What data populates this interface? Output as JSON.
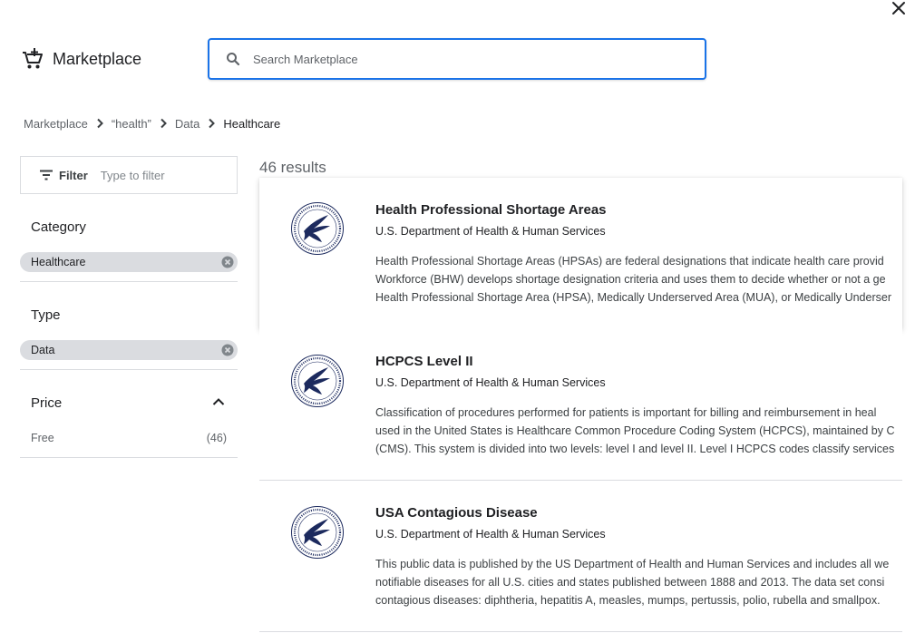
{
  "header": {
    "title": "Marketplace",
    "brand_icon": "cart-icon",
    "close_icon": "close-icon"
  },
  "search": {
    "placeholder": "Search Marketplace",
    "value": ""
  },
  "breadcrumb": [
    "Marketplace",
    "“health”",
    "Data",
    "Healthcare"
  ],
  "filter": {
    "label": "Filter",
    "placeholder": "Type to filter"
  },
  "facets": {
    "category": {
      "title": "Category",
      "chip": "Healthcare"
    },
    "type": {
      "title": "Type",
      "chip": "Data"
    },
    "price": {
      "title": "Price",
      "option": "Free",
      "count": "(46)"
    }
  },
  "results": {
    "count_label": "46 results",
    "items": [
      {
        "title": "Health Professional Shortage Areas",
        "publisher": "U.S. Department of Health & Human Services",
        "description": [
          "Health Professional Shortage Areas (HPSAs) are federal designations that indicate health care provid",
          "Workforce (BHW) develops shortage designation criteria and uses them to decide whether or not a ge",
          "Health Professional Shortage Area (HPSA), Medically Underserved Area (MUA), or Medically Underser"
        ]
      },
      {
        "title": "HCPCS Level II",
        "publisher": "U.S. Department of Health & Human Services",
        "description": [
          "Classification of procedures performed for patients is important for billing and reimbursement in heal",
          "used in the United States is Healthcare Common Procedure Coding System (HCPCS), maintained by C",
          "(CMS). This system is divided into two levels: level I and level II. Level I HCPCS codes classify services"
        ]
      },
      {
        "title": "USA Contagious Disease",
        "publisher": "U.S. Department of Health & Human Services",
        "description": [
          "This public data is published by the US Department of Health and Human Services and includes all we",
          "notifiable diseases for all U.S. cities and states published between 1888 and 2013. The data set consi",
          "contagious diseases: diphtheria, hepatitis A, measles, mumps, pertussis, polio, rubella and smallpox. "
        ]
      }
    ]
  },
  "colors": {
    "accent": "#1a73e8",
    "chip_bg": "#dadce0",
    "seal_navy": "#1c2a5e"
  }
}
